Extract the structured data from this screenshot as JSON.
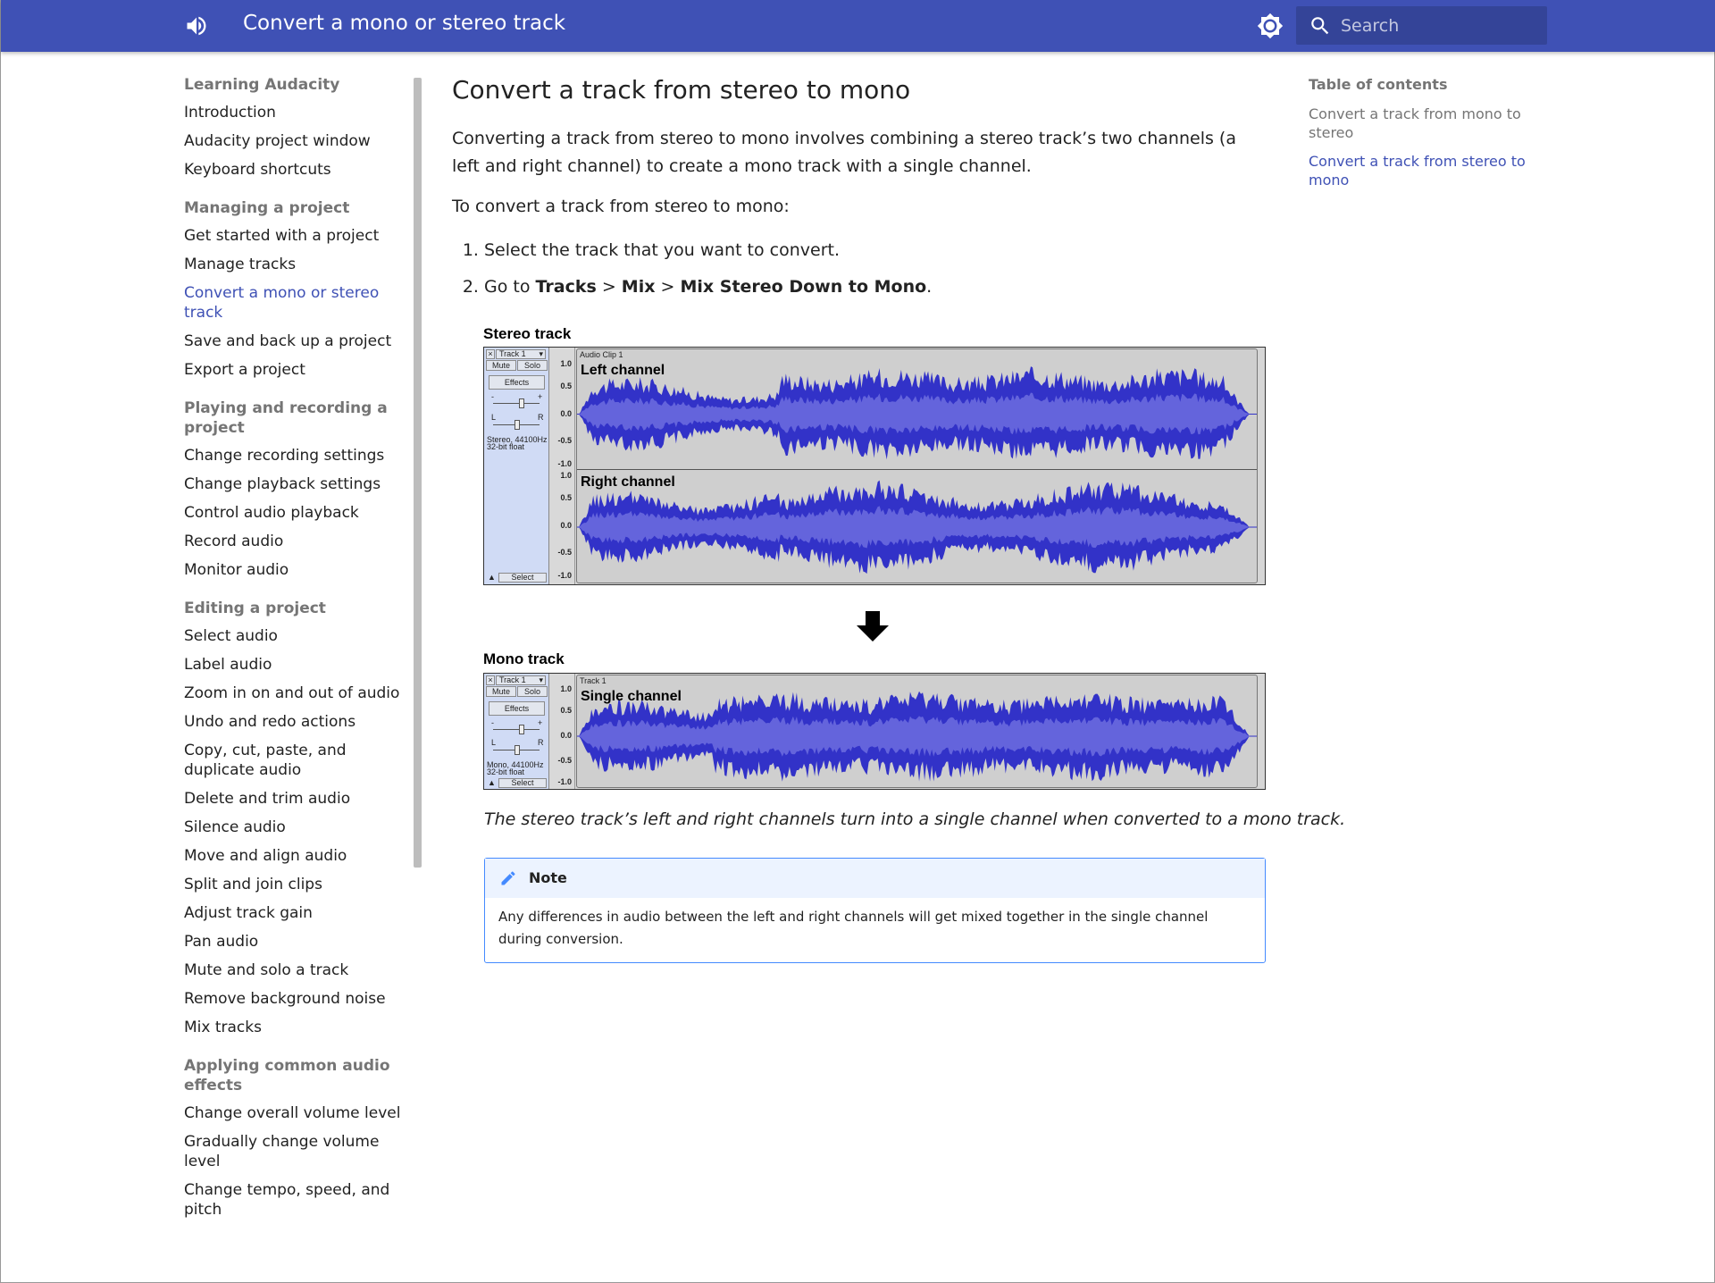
{
  "header": {
    "title": "Convert a mono or stereo track",
    "search_placeholder": "Search",
    "colors": {
      "primary": "#3f51b5",
      "accent": "#448aff"
    }
  },
  "nav": {
    "sections": [
      {
        "title": "Learning Audacity",
        "items": [
          "Introduction",
          "Audacity project window",
          "Keyboard shortcuts"
        ]
      },
      {
        "title": "Managing a project",
        "items": [
          "Get started with a project",
          "Manage tracks",
          "Convert a mono or stereo track",
          "Save and back up a project",
          "Export a project"
        ]
      },
      {
        "title": "Playing and recording a project",
        "items": [
          "Change recording settings",
          "Change playback settings",
          "Control audio playback",
          "Record audio",
          "Monitor audio"
        ]
      },
      {
        "title": "Editing a project",
        "items": [
          "Select audio",
          "Label audio",
          "Zoom in on and out of audio",
          "Undo and redo actions",
          "Copy, cut, paste, and duplicate audio",
          "Delete and trim audio",
          "Silence audio",
          "Move and align audio",
          "Split and join clips",
          "Adjust track gain",
          "Pan audio",
          "Mute and solo a track",
          "Remove background noise",
          "Mix tracks"
        ]
      },
      {
        "title": "Applying common audio effects",
        "items": [
          "Change overall volume level",
          "Gradually change volume level",
          "Change tempo, speed, and pitch"
        ]
      }
    ],
    "active_item": "Convert a mono or stereo track"
  },
  "main": {
    "heading": "Convert a track from stereo to mono",
    "intro": "Converting a track from stereo to mono involves combining a stereo track’s two channels (a left and right channel) to create a mono track with a single channel.",
    "lead": "To convert a track from stereo to mono:",
    "step1": "Select the track that you want to convert.",
    "step2": {
      "prefix": "Go to ",
      "tracks": "Tracks",
      "sep": " > ",
      "mix": "Mix",
      "action": "Mix Stereo Down to Mono",
      "end": "."
    },
    "figure": {
      "stereo_label": "Stereo track",
      "mono_label": "Mono track",
      "stereo_track": {
        "name": "Track 1",
        "mute": "Mute",
        "solo": "Solo",
        "effects": "Effects",
        "info1": "Stereo, 44100Hz",
        "info2": "32-bit float",
        "select": "Select",
        "clip_name": "Audio Clip 1",
        "channel1": "Left channel",
        "channel2": "Right channel"
      },
      "mono_track": {
        "name": "Track 1",
        "mute": "Mute",
        "solo": "Solo",
        "effects": "Effects",
        "info1": "Mono, 44100Hz",
        "info2": "32-bit float",
        "select": "Select",
        "clip_name": "Track 1",
        "channel1": "Single channel"
      },
      "ruler_ticks": [
        "1.0",
        "0.5",
        "0.0",
        "-0.5",
        "-1.0"
      ],
      "gain_minus": "-",
      "gain_plus": "+",
      "pan_left": "L",
      "pan_right": "R",
      "waveform_color": "#3232c8",
      "waveform_rms_color": "#6464dc"
    },
    "caption": "The stereo track’s left and right channels turn into a single channel when converted to a mono track.",
    "note": {
      "title": "Note",
      "body": "Any differences in audio between the left and right channels will get mixed together in the single channel during conversion."
    }
  },
  "toc": {
    "title": "Table of contents",
    "items": [
      "Convert a track from mono to stereo",
      "Convert a track from stereo to mono"
    ],
    "active_index": 1
  }
}
